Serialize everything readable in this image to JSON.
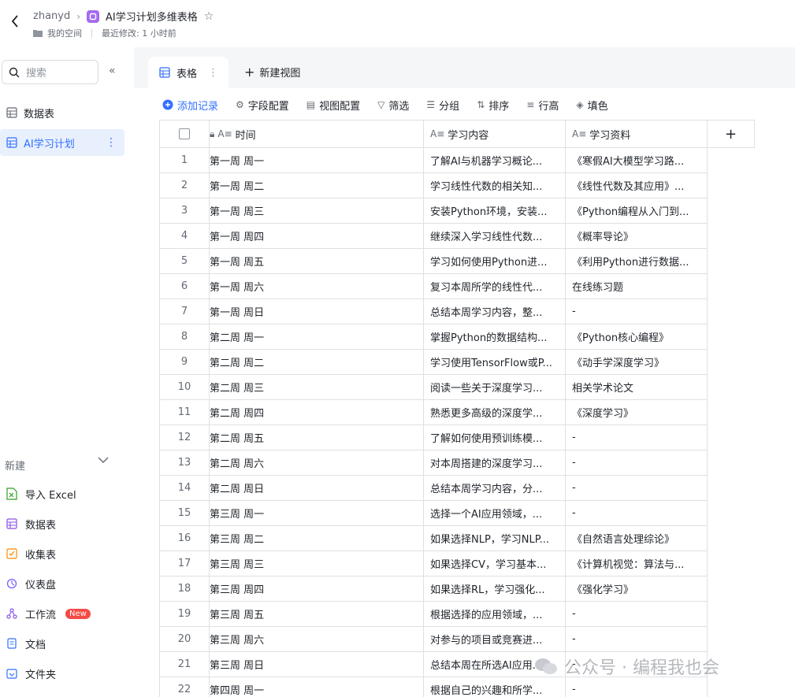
{
  "header": {
    "owner": "zhanyd",
    "title": "AI学习计划多维表格",
    "space": "我的空间",
    "modified": "最近修改: 1 小时前"
  },
  "sidebar": {
    "search_placeholder": "搜索",
    "items": [
      {
        "label": "数据表",
        "active": false
      },
      {
        "label": "AI学习计划",
        "active": true
      }
    ],
    "new_label": "新建",
    "new_items": [
      {
        "label": "导入 Excel",
        "icon": "excel-icon",
        "color": "#2ea121"
      },
      {
        "label": "数据表",
        "icon": "table-icon",
        "color": "#8a52e8"
      },
      {
        "label": "收集表",
        "icon": "form-icon",
        "color": "#ff8800"
      },
      {
        "label": "仪表盘",
        "icon": "dashboard-icon",
        "color": "#7b61ff"
      },
      {
        "label": "工作流",
        "icon": "workflow-icon",
        "color": "#8a52e8",
        "badge": "New"
      },
      {
        "label": "文档",
        "icon": "doc-icon",
        "color": "#3370ff"
      },
      {
        "label": "文件夹",
        "icon": "folder-icon",
        "color": "#3370ff"
      }
    ]
  },
  "tabs": {
    "active_tab": "表格",
    "new_view": "新建视图"
  },
  "toolbar": {
    "add_record": "添加记录",
    "field_config": "字段配置",
    "view_config": "视图配置",
    "filter": "筛选",
    "group": "分组",
    "sort": "排序",
    "row_height": "行高",
    "fill": "填色"
  },
  "table": {
    "columns": [
      "时间",
      "学习内容",
      "学习资料"
    ],
    "rows": [
      {
        "idx": "1",
        "time": "第一周 周一",
        "content": "了解AI与机器学习概论...",
        "res": "《寒假AI大模型学习路..."
      },
      {
        "idx": "2",
        "time": "第一周 周二",
        "content": "学习线性代数的相关知...",
        "res": "《线性代数及其应用》..."
      },
      {
        "idx": "3",
        "time": "第一周 周三",
        "content": "安装Python环境，安装...",
        "res": "《Python编程从入门到..."
      },
      {
        "idx": "4",
        "time": "第一周 周四",
        "content": "继续深入学习线性代数...",
        "res": "《概率导论》"
      },
      {
        "idx": "5",
        "time": "第一周 周五",
        "content": "学习如何使用Python进...",
        "res": "《利用Python进行数据..."
      },
      {
        "idx": "6",
        "time": "第一周 周六",
        "content": "复习本周所学的线性代...",
        "res": "在线练习题"
      },
      {
        "idx": "7",
        "time": "第一周 周日",
        "content": "总结本周学习内容，整...",
        "res": "-"
      },
      {
        "idx": "8",
        "time": "第二周 周一",
        "content": "掌握Python的数据结构...",
        "res": "《Python核心编程》"
      },
      {
        "idx": "9",
        "time": "第二周 周二",
        "content": "学习使用TensorFlow或P...",
        "res": "《动手学深度学习》"
      },
      {
        "idx": "10",
        "time": "第二周 周三",
        "content": "阅读一些关于深度学习...",
        "res": "相关学术论文"
      },
      {
        "idx": "11",
        "time": "第二周 周四",
        "content": "熟悉更多高级的深度学...",
        "res": "《深度学习》"
      },
      {
        "idx": "12",
        "time": "第二周 周五",
        "content": "了解如何使用预训练模...",
        "res": "-"
      },
      {
        "idx": "13",
        "time": "第二周 周六",
        "content": "对本周搭建的深度学习...",
        "res": "-"
      },
      {
        "idx": "14",
        "time": "第二周 周日",
        "content": "总结本周学习内容，分...",
        "res": "-"
      },
      {
        "idx": "15",
        "time": "第三周 周一",
        "content": "选择一个AI应用领域，...",
        "res": "-"
      },
      {
        "idx": "16",
        "time": "第三周 周二",
        "content": "如果选择NLP，学习NLP...",
        "res": "《自然语言处理综论》"
      },
      {
        "idx": "17",
        "time": "第三周 周三",
        "content": "如果选择CV，学习基本...",
        "res": "《计算机视觉：算法与..."
      },
      {
        "idx": "18",
        "time": "第三周 周四",
        "content": "如果选择RL，学习强化...",
        "res": "《强化学习》"
      },
      {
        "idx": "19",
        "time": "第三周 周五",
        "content": "根据选择的应用领域，...",
        "res": "-"
      },
      {
        "idx": "20",
        "time": "第三周 周六",
        "content": "对参与的项目或竞赛进...",
        "res": "-"
      },
      {
        "idx": "21",
        "time": "第三周 周日",
        "content": "总结本周在所选AI应用...",
        "res": "-"
      },
      {
        "idx": "22",
        "time": "第四周 周一",
        "content": "根据自己的兴趣和所学...",
        "res": "-"
      }
    ]
  },
  "watermark": "公众号 · 编程我也会",
  "colors": {
    "accent": "#3370ff",
    "active_bg": "#e8f0fd",
    "badge": "#f54a45"
  }
}
